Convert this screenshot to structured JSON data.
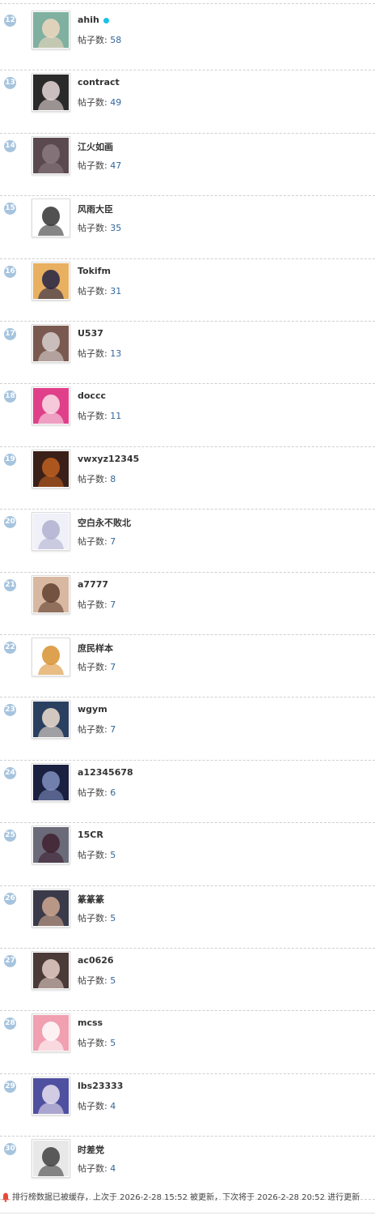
{
  "ranking": {
    "posts_label": "帖子数: ",
    "rows": [
      {
        "rank": "12",
        "name": "ahih",
        "online": true,
        "posts": "58",
        "bg": "#7fb0a0",
        "fg": "#f0d8c0"
      },
      {
        "rank": "13",
        "name": "contract",
        "online": false,
        "posts": "49",
        "bg": "#2a2a2a",
        "fg": "#e8d8d8"
      },
      {
        "rank": "14",
        "name": "江火如画",
        "online": false,
        "posts": "47",
        "bg": "#5a4a50",
        "fg": "#8a7a7f"
      },
      {
        "rank": "15",
        "name": "风雨大臣",
        "online": false,
        "posts": "35",
        "bg": "#ffffff",
        "fg": "#333333"
      },
      {
        "rank": "16",
        "name": "Tokifm",
        "online": false,
        "posts": "31",
        "bg": "#e8b060",
        "fg": "#222244"
      },
      {
        "rank": "17",
        "name": "U537",
        "online": false,
        "posts": "13",
        "bg": "#7a5a50",
        "fg": "#d8d0d0"
      },
      {
        "rank": "18",
        "name": "doccc",
        "online": false,
        "posts": "11",
        "bg": "#e0408a",
        "fg": "#f8e0e8"
      },
      {
        "rank": "19",
        "name": "vwxyz12345",
        "online": false,
        "posts": "8",
        "bg": "#3a2018",
        "fg": "#c06020"
      },
      {
        "rank": "20",
        "name": "空白永不败北",
        "online": false,
        "posts": "7",
        "bg": "#f0f0f8",
        "fg": "#b0b0d0"
      },
      {
        "rank": "21",
        "name": "a7777",
        "online": false,
        "posts": "7",
        "bg": "#d8b8a0",
        "fg": "#604030"
      },
      {
        "rank": "22",
        "name": "庶民样本",
        "online": false,
        "posts": "7",
        "bg": "#ffffff",
        "fg": "#d89030"
      },
      {
        "rank": "23",
        "name": "wgym",
        "online": false,
        "posts": "7",
        "bg": "#2a4060",
        "fg": "#f0e0d0"
      },
      {
        "rank": "24",
        "name": "a12345678",
        "online": false,
        "posts": "6",
        "bg": "#1a2040",
        "fg": "#8090c0"
      },
      {
        "rank": "25",
        "name": "15CR",
        "online": false,
        "posts": "5",
        "bg": "#6a6a78",
        "fg": "#402030"
      },
      {
        "rank": "26",
        "name": "篆篆篆",
        "online": false,
        "posts": "5",
        "bg": "#3a3a4a",
        "fg": "#d0a890"
      },
      {
        "rank": "27",
        "name": "ac0626",
        "online": false,
        "posts": "5",
        "bg": "#4a3a38",
        "fg": "#e8d0c8"
      },
      {
        "rank": "28",
        "name": "mcss",
        "online": false,
        "posts": "5",
        "bg": "#f0a0b0",
        "fg": "#ffffff"
      },
      {
        "rank": "29",
        "name": "lbs23333",
        "online": false,
        "posts": "4",
        "bg": "#5050a0",
        "fg": "#e8e0f0"
      },
      {
        "rank": "30",
        "name": "时差党",
        "online": false,
        "posts": "4",
        "bg": "#e8e8e8",
        "fg": "#404040"
      }
    ]
  },
  "footer": {
    "text": "排行榜数据已被缓存，上次于 2026-2-28 15:52 被更新，下次将于 2026-2-28 20:52 进行更新",
    "icon": "bell-icon",
    "icon_color": "#e64b3c"
  },
  "colors": {
    "rank_badge": "#a6c4de",
    "online_dot": "#19c2e8",
    "post_count": "#336699"
  }
}
